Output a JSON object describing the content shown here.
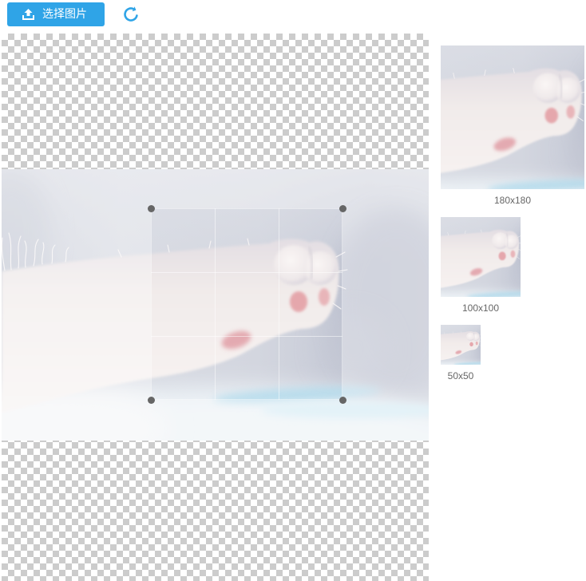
{
  "toolbar": {
    "select_image_button": {
      "label": "选择图片",
      "icon": "upload-icon"
    },
    "refresh_button": {
      "icon": "refresh-icon"
    }
  },
  "previews": [
    {
      "label": "180x180"
    },
    {
      "label": "100x100"
    },
    {
      "label": "50x50"
    }
  ],
  "colors": {
    "accent": "#2fa4e7",
    "handle": "#666666",
    "label_text": "#666666",
    "checker_dark": "#cccccc",
    "checker_light": "#ffffff"
  }
}
